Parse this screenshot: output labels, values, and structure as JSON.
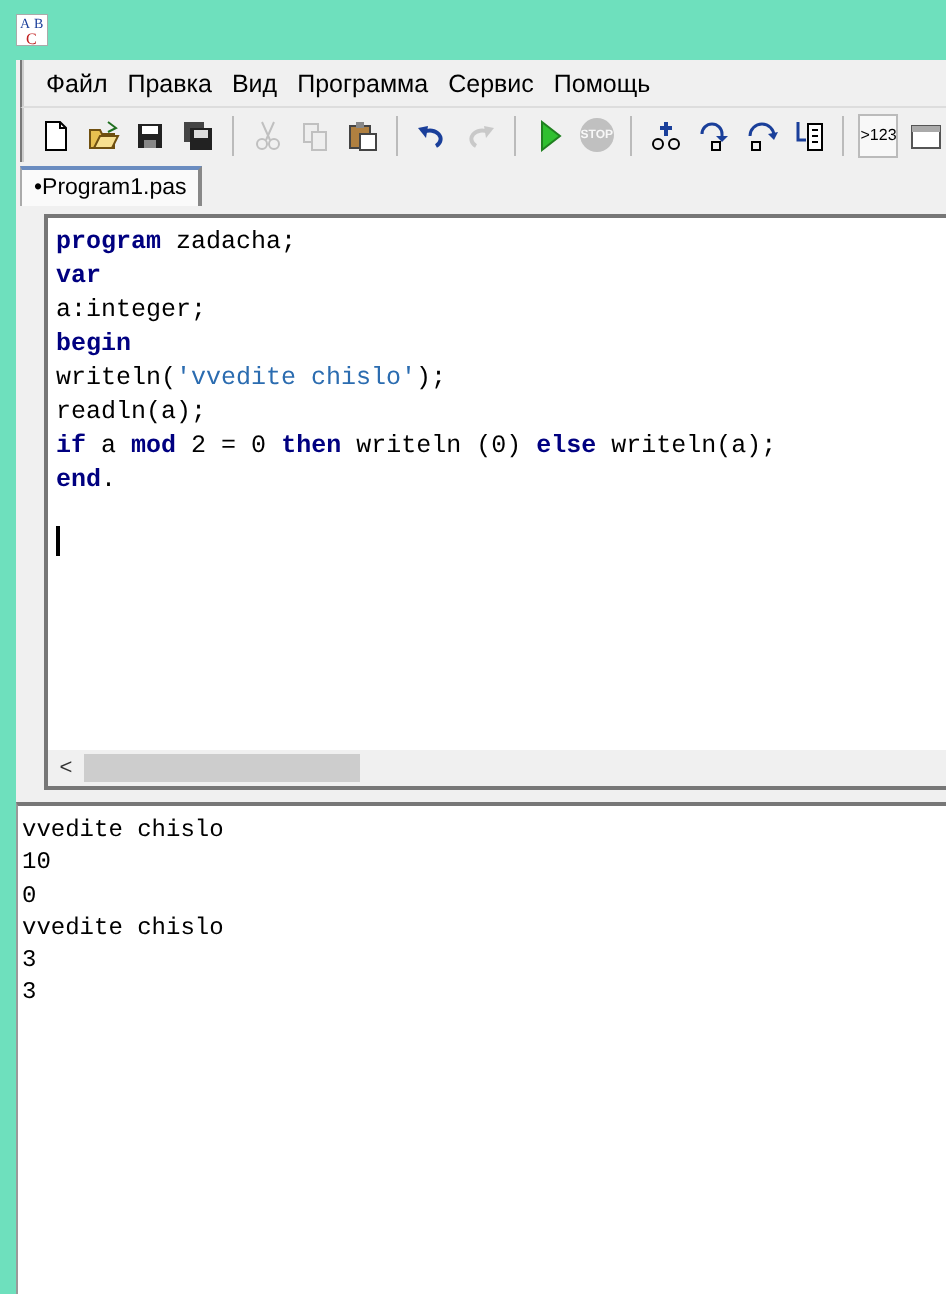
{
  "app_icon": {
    "letters": [
      "A",
      "B",
      "C"
    ]
  },
  "menu": [
    "Файл",
    "Правка",
    "Вид",
    "Программа",
    "Сервис",
    "Помощь"
  ],
  "toolbar": [
    {
      "kind": "new",
      "disabled": false
    },
    {
      "kind": "open",
      "disabled": false
    },
    {
      "kind": "save",
      "disabled": false
    },
    {
      "kind": "saveall",
      "disabled": false
    },
    {
      "kind": "sep"
    },
    {
      "kind": "cut",
      "disabled": true
    },
    {
      "kind": "copy",
      "disabled": true
    },
    {
      "kind": "paste",
      "disabled": false
    },
    {
      "kind": "sep"
    },
    {
      "kind": "undo",
      "disabled": false
    },
    {
      "kind": "redo",
      "disabled": true
    },
    {
      "kind": "sep"
    },
    {
      "kind": "run",
      "disabled": false
    },
    {
      "kind": "stop",
      "disabled": true,
      "label": "STOP"
    },
    {
      "kind": "sep"
    },
    {
      "kind": "watch",
      "disabled": false
    },
    {
      "kind": "stepinto",
      "disabled": false
    },
    {
      "kind": "stepover",
      "disabled": false
    },
    {
      "kind": "tocursor",
      "disabled": false
    },
    {
      "kind": "sep"
    },
    {
      "kind": "output",
      "disabled": false,
      "label": ">123"
    },
    {
      "kind": "window",
      "disabled": false
    }
  ],
  "tabs": [
    {
      "label": "•Program1.pas",
      "selected": true
    }
  ],
  "editor": {
    "lines": [
      [
        {
          "kind": "keyword",
          "text": "program"
        },
        {
          "kind": "plain",
          "text": " zadacha;"
        }
      ],
      [
        {
          "kind": "keyword",
          "text": "var"
        }
      ],
      [
        {
          "kind": "plain",
          "text": "a:integer;"
        }
      ],
      [
        {
          "kind": "keyword",
          "text": "begin"
        }
      ],
      [
        {
          "kind": "plain",
          "text": "writeln("
        },
        {
          "kind": "string",
          "text": "'vvedite chislo'"
        },
        {
          "kind": "plain",
          "text": ");"
        }
      ],
      [
        {
          "kind": "plain",
          "text": "readln(a);"
        }
      ],
      [
        {
          "kind": "keyword",
          "text": "if"
        },
        {
          "kind": "plain",
          "text": " a "
        },
        {
          "kind": "keyword",
          "text": "mod"
        },
        {
          "kind": "plain",
          "text": " 2 = 0 "
        },
        {
          "kind": "keyword",
          "text": "then"
        },
        {
          "kind": "plain",
          "text": " writeln (0) "
        },
        {
          "kind": "keyword",
          "text": "else"
        },
        {
          "kind": "plain",
          "text": " writeln(a);"
        }
      ],
      [
        {
          "kind": "keyword",
          "text": "end"
        },
        {
          "kind": "plain",
          "text": "."
        }
      ]
    ],
    "scroll_left": "<"
  },
  "output": [
    "vvedite chislo",
    "10",
    "0",
    "vvedite chislo",
    "3",
    "3"
  ]
}
